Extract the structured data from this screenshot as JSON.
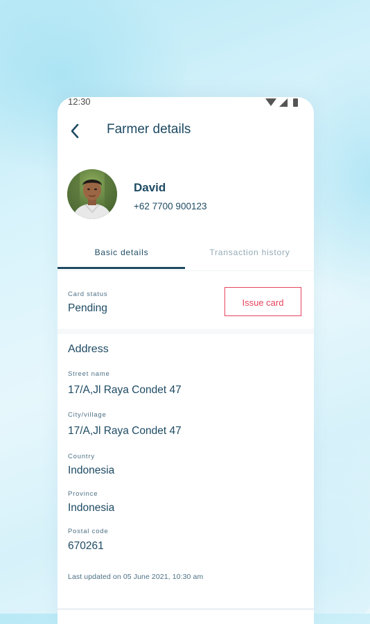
{
  "status_bar": {
    "time": "12:30"
  },
  "app_bar": {
    "title": "Farmer details"
  },
  "profile": {
    "name": "David",
    "phone": "+62 7700 900123"
  },
  "tabs": [
    {
      "label": "Basic details",
      "active": true
    },
    {
      "label": "Transaction history",
      "active": false
    }
  ],
  "card_status": {
    "label": "Card status",
    "value": "Pending",
    "button_label": "Issue card"
  },
  "address": {
    "title": "Address",
    "fields": [
      {
        "label": "Street name",
        "value": "17/A,Jl Raya Condet 47"
      },
      {
        "label": "City/village",
        "value": "17/A,Jl Raya Condet 47"
      },
      {
        "label": "Country",
        "value": "Indonesia"
      },
      {
        "label": "Province",
        "value": "Indonesia"
      },
      {
        "label": "Postal code",
        "value": "670261"
      }
    ]
  },
  "footer": {
    "last_updated": "Last updated on 05 June 2021, 10:30 am"
  },
  "colors": {
    "primary": "#1e4a63",
    "accent": "#e6435d",
    "muted": "#93a9b6"
  },
  "icons": {
    "back": "chevron-left-icon",
    "wifi": "wifi-icon",
    "signal": "signal-icon",
    "battery": "battery-icon"
  }
}
